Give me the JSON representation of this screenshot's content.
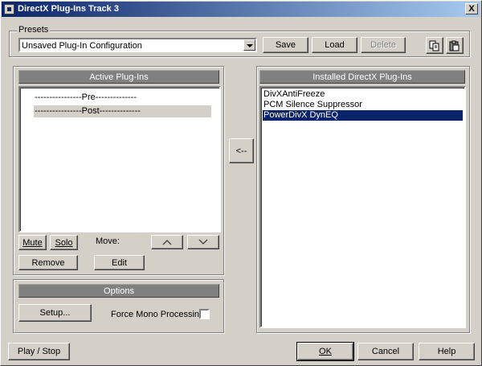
{
  "window": {
    "title": "DirectX Plug-Ins Track 3",
    "close": "X"
  },
  "presets": {
    "group_label": "Presets",
    "selected": "Unsaved Plug-In Configuration",
    "save": "Save",
    "load": "Load",
    "delete": "Delete"
  },
  "active": {
    "header": "Active Plug-Ins",
    "items": [
      "----------------Pre--------------",
      "----------------Post--------------"
    ],
    "mute": "Mute",
    "solo": "Solo",
    "move_label": "Move:",
    "remove": "Remove",
    "edit": "Edit"
  },
  "transfer": {
    "add": "<--"
  },
  "installed": {
    "header": "Installed DirectX Plug-Ins",
    "items": [
      "DivXAntiFreeze",
      "PCM Silence Suppressor",
      "PowerDivX DynEQ"
    ],
    "selected_index": 2
  },
  "options": {
    "header": "Options",
    "setup": "Setup...",
    "force_mono": "Force Mono Processing"
  },
  "footer": {
    "play_stop": "Play / Stop",
    "ok": "OK",
    "cancel": "Cancel",
    "help": "Help"
  }
}
